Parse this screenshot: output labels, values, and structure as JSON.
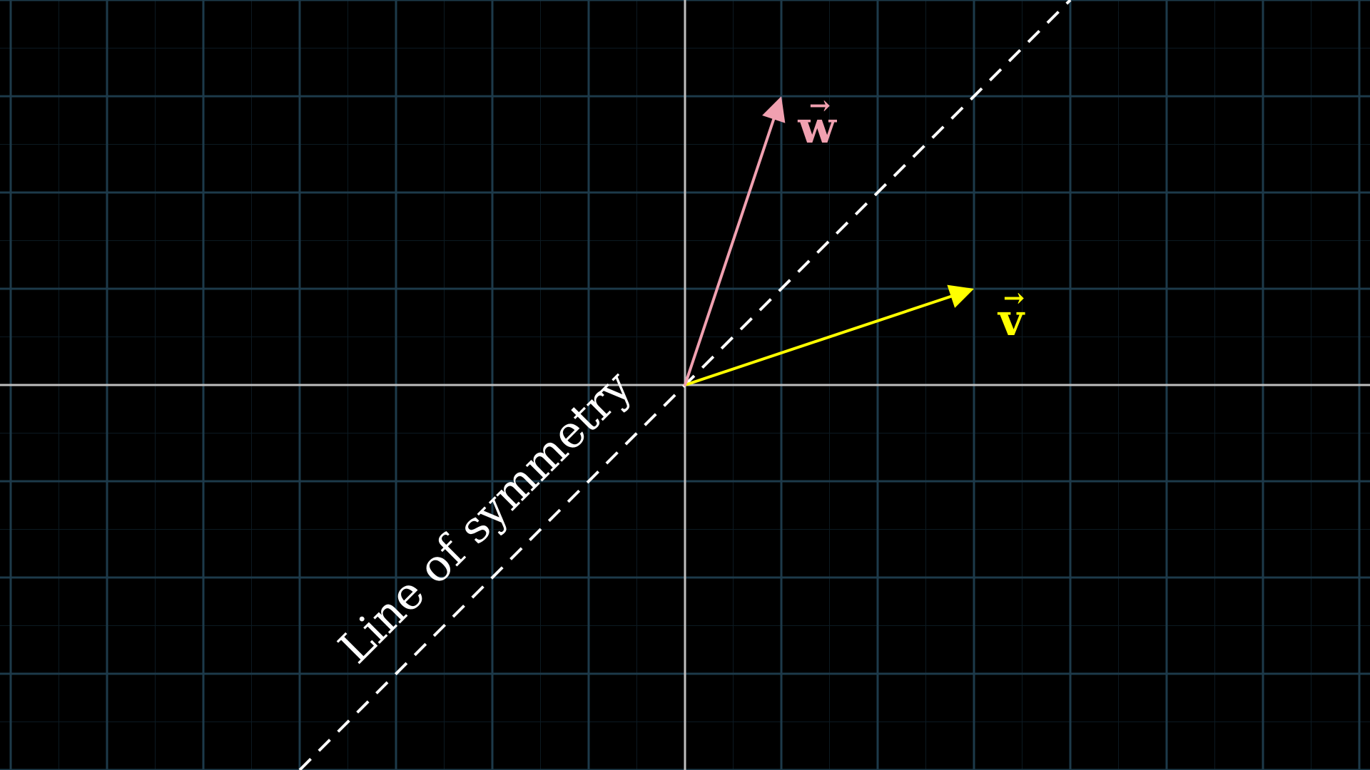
{
  "diagram": {
    "background": "#000000",
    "colors": {
      "grid_major": "#1d3a4a",
      "grid_minor": "#0c1a22",
      "axis": "#bfbfbf",
      "symmetry_line": "#ffffff",
      "vector_v": "#ffff00",
      "vector_w": "#f0a0b0",
      "caption": "#ffffff"
    },
    "vectors": [
      {
        "id": "v",
        "label": "v",
        "arrow": "→",
        "components": [
          3,
          1
        ],
        "color_key": "vector_v"
      },
      {
        "id": "w",
        "label": "w",
        "arrow": "→",
        "components": [
          1,
          3
        ],
        "color_key": "vector_w"
      }
    ],
    "symmetry": {
      "slope": 1,
      "label": "Line of symmetry"
    }
  }
}
